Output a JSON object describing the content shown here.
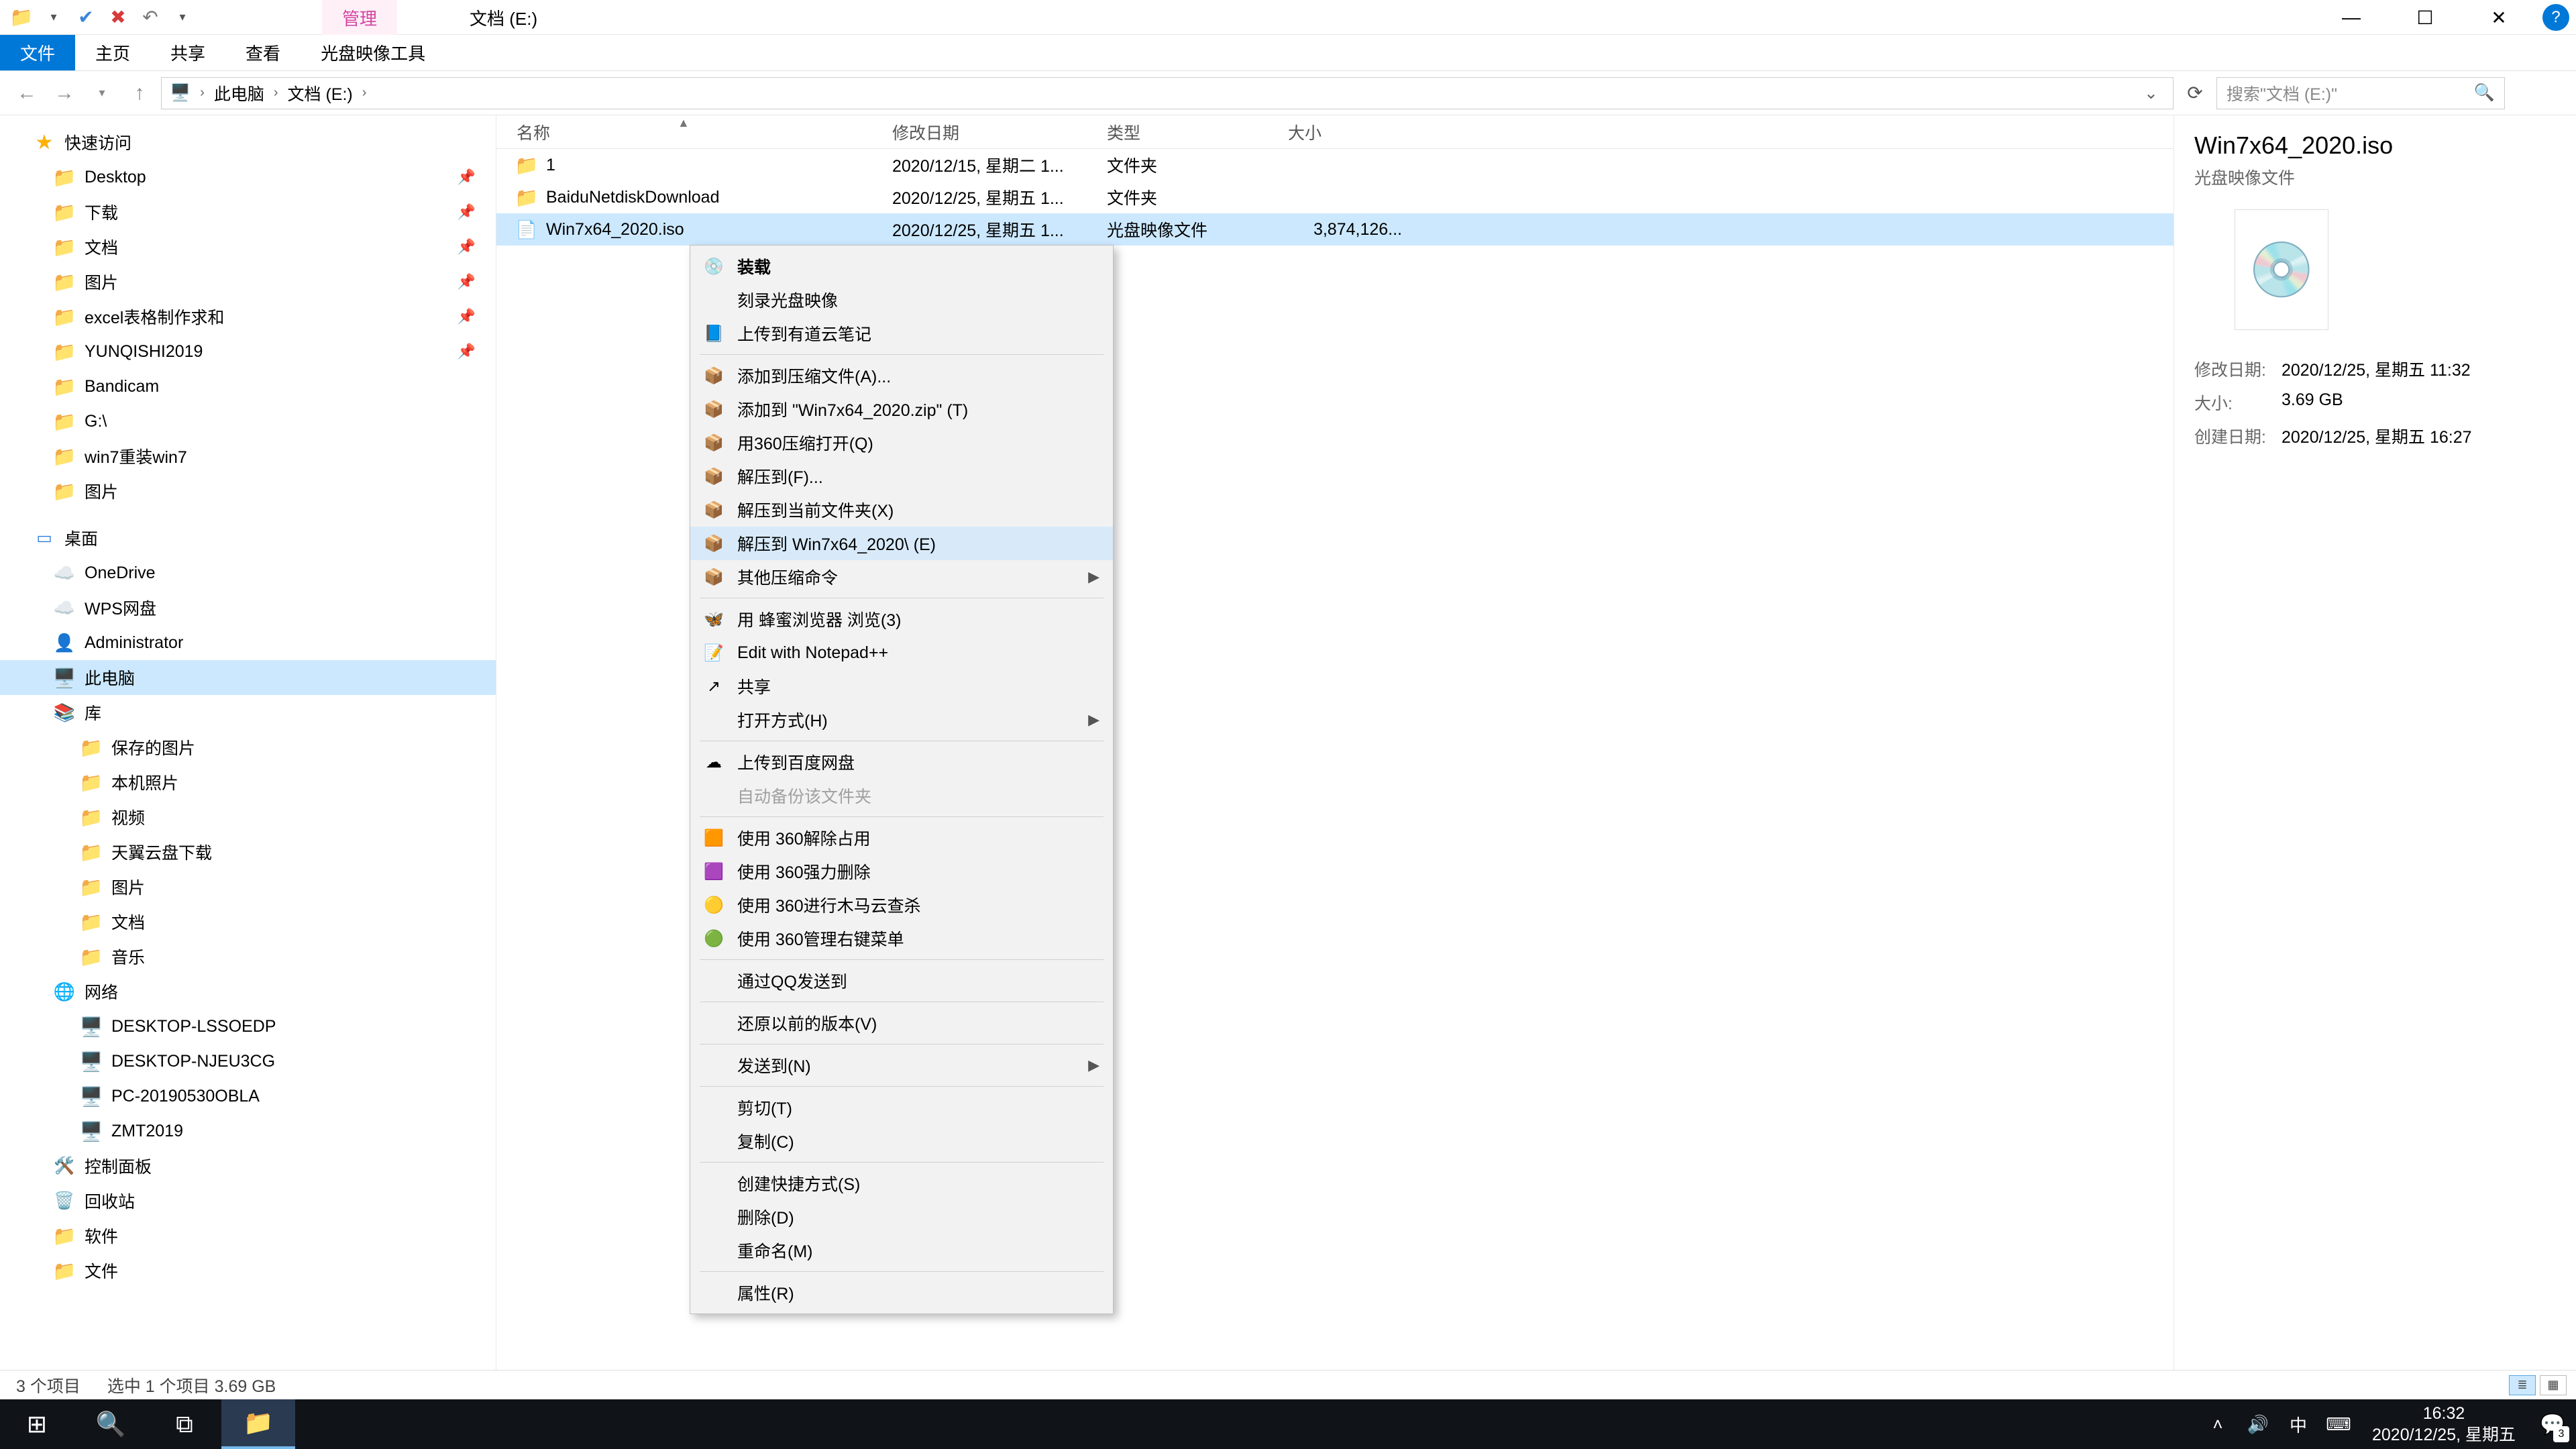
{
  "title": {
    "context_tab": "管理",
    "window_title": "文档 (E:)"
  },
  "ribbon": {
    "file": "文件",
    "home": "主页",
    "share": "共享",
    "view": "查看",
    "drive_tools": "光盘映像工具"
  },
  "nav": {
    "crumbs": [
      "此电脑",
      "文档 (E:)"
    ],
    "search_placeholder": "搜索\"文档 (E:)\""
  },
  "tree": {
    "quick_access": "快速访问",
    "quick": [
      {
        "label": "Desktop",
        "pinned": true
      },
      {
        "label": "下载",
        "pinned": true
      },
      {
        "label": "文档",
        "pinned": true
      },
      {
        "label": "图片",
        "pinned": true
      },
      {
        "label": "excel表格制作求和",
        "pinned": true
      },
      {
        "label": "YUNQISHI2019",
        "pinned": true
      },
      {
        "label": "Bandicam",
        "pinned": false
      },
      {
        "label": "G:\\",
        "pinned": false
      },
      {
        "label": "win7重装win7",
        "pinned": false
      },
      {
        "label": "图片",
        "pinned": false
      }
    ],
    "desktop": "桌面",
    "onedrive": "OneDrive",
    "wps": "WPS网盘",
    "admin": "Administrator",
    "thispc": "此电脑",
    "libraries": "库",
    "lib": [
      "保存的图片",
      "本机照片",
      "视频",
      "天翼云盘下载",
      "图片",
      "文档",
      "音乐"
    ],
    "network": "网络",
    "net": [
      "DESKTOP-LSSOEDP",
      "DESKTOP-NJEU3CG",
      "PC-20190530OBLA",
      "ZMT2019"
    ],
    "control_panel": "控制面板",
    "recycle": "回收站",
    "software": "软件",
    "files": "文件"
  },
  "columns": {
    "name": "名称",
    "date": "修改日期",
    "type": "类型",
    "size": "大小"
  },
  "rows": [
    {
      "name": "1",
      "date": "2020/12/15, 星期二 1...",
      "type": "文件夹",
      "size": "",
      "icon": "fold"
    },
    {
      "name": "BaiduNetdiskDownload",
      "date": "2020/12/25, 星期五 1...",
      "type": "文件夹",
      "size": "",
      "icon": "fold"
    },
    {
      "name": "Win7x64_2020.iso",
      "date": "2020/12/25, 星期五 1...",
      "type": "光盘映像文件",
      "size": "3,874,126...",
      "icon": "iso",
      "selected": true
    }
  ],
  "ctx": [
    {
      "t": "装载",
      "bold": true,
      "icon": "💿"
    },
    {
      "t": "刻录光盘映像"
    },
    {
      "t": "上传到有道云笔记",
      "icon": "📘"
    },
    {
      "sep": true
    },
    {
      "t": "添加到压缩文件(A)...",
      "icon": "📦"
    },
    {
      "t": "添加到 \"Win7x64_2020.zip\" (T)",
      "icon": "📦"
    },
    {
      "t": "用360压缩打开(Q)",
      "icon": "📦"
    },
    {
      "t": "解压到(F)...",
      "icon": "📦"
    },
    {
      "t": "解压到当前文件夹(X)",
      "icon": "📦"
    },
    {
      "t": "解压到 Win7x64_2020\\ (E)",
      "icon": "📦",
      "hover": true
    },
    {
      "t": "其他压缩命令",
      "icon": "📦",
      "sub": true
    },
    {
      "sep": true
    },
    {
      "t": "用 蜂蜜浏览器 浏览(3)",
      "icon": "🦋"
    },
    {
      "t": "Edit with Notepad++",
      "icon": "📝"
    },
    {
      "t": "共享",
      "icon": "↗"
    },
    {
      "t": "打开方式(H)",
      "sub": true
    },
    {
      "sep": true
    },
    {
      "t": "上传到百度网盘",
      "icon": "☁"
    },
    {
      "t": "自动备份该文件夹",
      "disabled": true
    },
    {
      "sep": true
    },
    {
      "t": "使用 360解除占用",
      "icon": "🟧"
    },
    {
      "t": "使用 360强力删除",
      "icon": "🟪"
    },
    {
      "t": "使用 360进行木马云查杀",
      "icon": "🟡"
    },
    {
      "t": "使用 360管理右键菜单",
      "icon": "🟢"
    },
    {
      "sep": true
    },
    {
      "t": "通过QQ发送到"
    },
    {
      "sep": true
    },
    {
      "t": "还原以前的版本(V)"
    },
    {
      "sep": true
    },
    {
      "t": "发送到(N)",
      "sub": true
    },
    {
      "sep": true
    },
    {
      "t": "剪切(T)"
    },
    {
      "t": "复制(C)"
    },
    {
      "sep": true
    },
    {
      "t": "创建快捷方式(S)"
    },
    {
      "t": "删除(D)"
    },
    {
      "t": "重命名(M)"
    },
    {
      "sep": true
    },
    {
      "t": "属性(R)"
    }
  ],
  "preview": {
    "title": "Win7x64_2020.iso",
    "type": "光盘映像文件",
    "meta": [
      {
        "k": "修改日期:",
        "v": "2020/12/25, 星期五 11:32"
      },
      {
        "k": "大小:",
        "v": "3.69 GB"
      },
      {
        "k": "创建日期:",
        "v": "2020/12/25, 星期五 16:27"
      }
    ]
  },
  "status": {
    "count": "3 个项目",
    "selection": "选中 1 个项目  3.69 GB"
  },
  "taskbar": {
    "time": "16:32",
    "date": "2020/12/25, 星期五",
    "ime": "中",
    "badge": "3"
  }
}
